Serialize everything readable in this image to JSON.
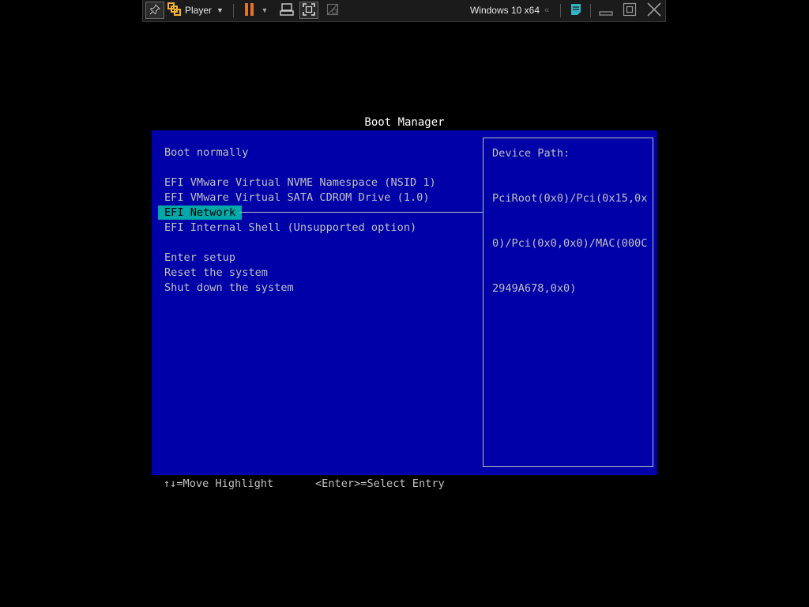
{
  "toolbar": {
    "player_label": "Player",
    "vm_name": "Windows 10 x64",
    "icons": {
      "pin": "pin-icon",
      "player": "vmware-logo-icon",
      "pause": "pause-icon",
      "send_keys": "send-ctrl-alt-del-icon",
      "fullscreen": "fullscreen-icon",
      "unity": "unity-icon",
      "back": "double-chevron-left-icon",
      "notes": "message-log-icon",
      "minimize": "minimize-icon",
      "restore": "restore-icon",
      "close": "close-icon"
    },
    "colors": {
      "pause": "#e8702a",
      "logo": "#f2b233",
      "notes": "#34b3c4"
    }
  },
  "boot_manager": {
    "title": "Boot Manager",
    "items": [
      {
        "label": "Boot normally",
        "selected": false
      },
      {
        "label": "EFI VMware Virtual NVME Namespace (NSID 1)",
        "selected": false
      },
      {
        "label": "EFI VMware Virtual SATA CDROM Drive (1.0)",
        "selected": false
      },
      {
        "label": "EFI Network",
        "selected": true
      },
      {
        "label": "EFI Internal Shell (Unsupported option)",
        "selected": false
      },
      {
        "label": "Enter setup",
        "selected": false
      },
      {
        "label": "Reset the system",
        "selected": false
      },
      {
        "label": "Shut down the system",
        "selected": false
      }
    ],
    "info": {
      "label": "Device Path:",
      "value_lines": [
        "PciRoot(0x0)/Pci(0x15,0x",
        "0)/Pci(0x0,0x0)/MAC(000C",
        "2949A678,0x0)"
      ]
    },
    "help": {
      "move": "↑↓=Move Highlight",
      "select": "<Enter>=Select Entry"
    },
    "colors": {
      "background": "#0000a8",
      "text": "#c0c0c0",
      "highlight": "#00a8a8"
    }
  }
}
